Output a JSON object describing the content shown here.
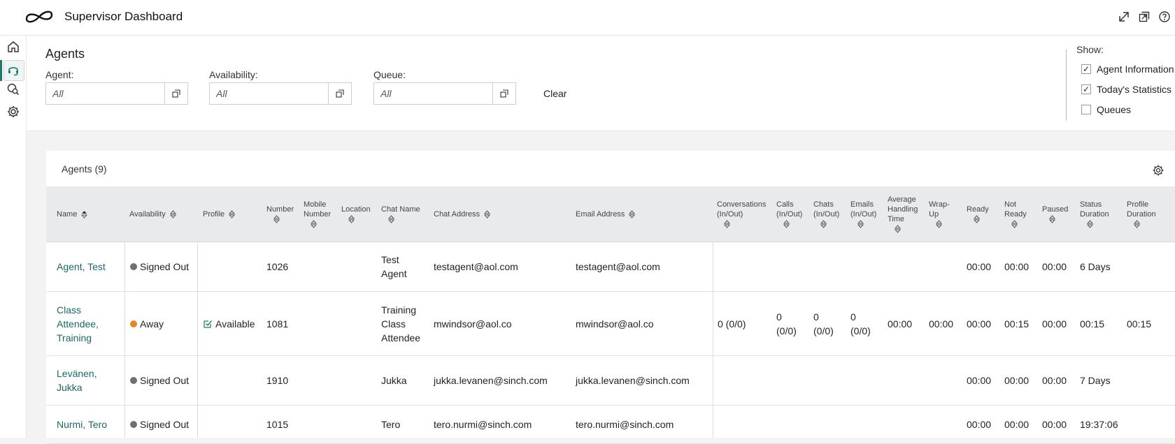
{
  "header": {
    "title": "Supervisor Dashboard"
  },
  "filters": {
    "title": "Agents",
    "agent": {
      "label": "Agent:",
      "placeholder": "All"
    },
    "availability": {
      "label": "Availability:",
      "placeholder": "All"
    },
    "queue": {
      "label": "Queue:",
      "placeholder": "All"
    },
    "clear_label": "Clear"
  },
  "show": {
    "label": "Show:",
    "options": [
      {
        "label": "Agent Information",
        "checked": true
      },
      {
        "label": "Today's Statistics",
        "checked": true
      },
      {
        "label": "Queues",
        "checked": false
      }
    ]
  },
  "table": {
    "title": "Agents (9)",
    "columns": {
      "name": "Name",
      "availability": "Availability",
      "profile": "Profile",
      "number": "Number",
      "mobile_1": "Mobile",
      "mobile_2": "Number",
      "location": "Location",
      "chat_name": "Chat Name",
      "chat_address": "Chat Address",
      "email_address": "Email Address",
      "conv_1": "Conversations",
      "conv_2": "(In/Out)",
      "calls_1": "Calls",
      "calls_2": "(In/Out)",
      "chats_1": "Chats",
      "chats_2": "(In/Out)",
      "emails_1": "Emails",
      "emails_2": "(In/Out)",
      "aht_1": "Average",
      "aht_2": "Handling",
      "aht_3": "Time",
      "wrap_1": "Wrap-",
      "wrap_2": "Up",
      "ready": "Ready",
      "notready_1": "Not",
      "notready_2": "Ready",
      "paused": "Paused",
      "status_1": "Status",
      "status_2": "Duration",
      "profile_dur_1": "Profile",
      "profile_dur_2": "Duration"
    },
    "rows": [
      {
        "name_1": "Agent, Test",
        "name_2": "",
        "name_3": "",
        "availability": "Signed Out",
        "profile": "",
        "number": "1026",
        "chat_name_1": "Test",
        "chat_name_2": "Agent",
        "chat_name_3": "",
        "chat_address": "testagent@aol.com",
        "email_address": "testagent@aol.com",
        "conversations": "",
        "calls_1": "",
        "calls_2": "",
        "chats_1": "",
        "chats_2": "",
        "emails_1": "",
        "emails_2": "",
        "aht": "",
        "wrap_up": "",
        "ready": "00:00",
        "not_ready": "00:00",
        "paused": "00:00",
        "status_duration": "6 Days",
        "profile_duration": ""
      },
      {
        "name_1": "Class",
        "name_2": "Attendee,",
        "name_3": "Training",
        "availability": "Away",
        "profile": "Available",
        "number": "1081",
        "chat_name_1": "Training",
        "chat_name_2": "Class",
        "chat_name_3": "Attendee",
        "chat_address": "mwindsor@aol.co",
        "email_address": "mwindsor@aol.co",
        "conversations": "0 (0/0)",
        "calls_1": "0",
        "calls_2": "(0/0)",
        "chats_1": "0",
        "chats_2": "(0/0)",
        "emails_1": "0",
        "emails_2": "(0/0)",
        "aht": "00:00",
        "wrap_up": "00:00",
        "ready": "00:00",
        "not_ready": "00:15",
        "paused": "00:00",
        "status_duration": "00:15",
        "profile_duration": "00:15"
      },
      {
        "name_1": "Levänen,",
        "name_2": "Jukka",
        "name_3": "",
        "availability": "Signed Out",
        "profile": "",
        "number": "1910",
        "chat_name_1": "Jukka",
        "chat_name_2": "",
        "chat_name_3": "",
        "chat_address": "jukka.levanen@sinch.com",
        "email_address": "jukka.levanen@sinch.com",
        "conversations": "",
        "calls_1": "",
        "calls_2": "",
        "chats_1": "",
        "chats_2": "",
        "emails_1": "",
        "emails_2": "",
        "aht": "",
        "wrap_up": "",
        "ready": "00:00",
        "not_ready": "00:00",
        "paused": "00:00",
        "status_duration": "7 Days",
        "profile_duration": ""
      },
      {
        "name_1": "Nurmi, Tero",
        "name_2": "",
        "name_3": "",
        "availability": "Signed Out",
        "profile": "",
        "number": "1015",
        "chat_name_1": "Tero",
        "chat_name_2": "",
        "chat_name_3": "",
        "chat_address": "tero.nurmi@sinch.com",
        "email_address": "tero.nurmi@sinch.com",
        "conversations": "",
        "calls_1": "",
        "calls_2": "",
        "chats_1": "",
        "chats_2": "",
        "emails_1": "",
        "emails_2": "",
        "aht": "",
        "wrap_up": "",
        "ready": "00:00",
        "not_ready": "00:00",
        "paused": "00:00",
        "status_duration": "19:37:06",
        "profile_duration": ""
      }
    ]
  },
  "colors": {
    "accent": "#1f7a6c",
    "link": "#1a6a63",
    "signed_out": "#6b6f78",
    "away": "#e8842c"
  }
}
